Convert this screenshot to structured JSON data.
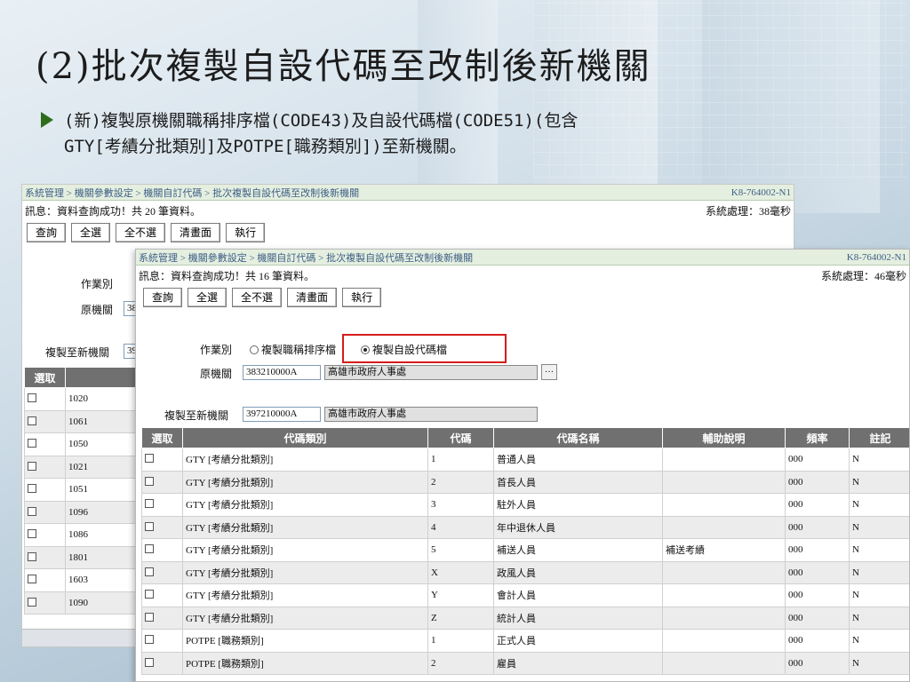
{
  "slide": {
    "title": "(2)批次複製自設代碼至改制後新機關",
    "bullet_line1": "(新)複製原機關職稱排序檔(CODE43)及自設代碼檔(CODE51)(包含",
    "bullet_line2": "GTY[考績分批類別]及POTPE[職務類別])至新機關。"
  },
  "back_window": {
    "breadcrumb": "系統管理 > 機關參數設定 > 機關自訂代碼 > 批次複製自設代碼至改制後新機關",
    "page_code": "K8-764002-N1",
    "message": "訊息：資料查詢成功！共 20 筆資料。",
    "timing": "系統處理：38毫秒",
    "buttons": [
      "查詢",
      "全選",
      "全不選",
      "清畫面",
      "執行"
    ],
    "label_work_type": "作業別",
    "label_orig_org": "原機關",
    "orig_org_partial": "38",
    "label_target_org": "複製至新機關",
    "target_org_partial": "39",
    "col_select": "選取",
    "codes": [
      "1020",
      "1061",
      "1050",
      "1021",
      "1051",
      "1096",
      "1086",
      "1801",
      "1603",
      "1090"
    ]
  },
  "front_window": {
    "breadcrumb": "系統管理 > 機關參數設定 > 機關自訂代碼 > 批次複製自設代碼至改制後新機關",
    "page_code": "K8-764002-N1",
    "message": "訊息：資料查詢成功！共 16 筆資料。",
    "timing": "系統處理：46毫秒",
    "buttons": {
      "query": "查詢",
      "select_all": "全選",
      "select_none": "全不選",
      "clear": "清畫面",
      "execute": "執行"
    },
    "work_type": {
      "label": "作業別",
      "option1": "複製職稱排序檔",
      "option2": "複製自設代碼檔",
      "selected": "option2"
    },
    "orig_org": {
      "label": "原機關",
      "code": "383210000A",
      "name": "高雄市政府人事處"
    },
    "target_org": {
      "label": "複製至新機關",
      "code": "397210000A",
      "name": "高雄市政府人事處"
    },
    "columns": [
      "選取",
      "代碼類別",
      "代碼",
      "代碼名稱",
      "輔助說明",
      "頻率",
      "註記"
    ],
    "rows": [
      {
        "category": "GTY [考績分批類別]",
        "code": "1",
        "name": "普通人員",
        "note": "",
        "freq": "000",
        "flag": "N"
      },
      {
        "category": "GTY [考績分批類別]",
        "code": "2",
        "name": "首長人員",
        "note": "",
        "freq": "000",
        "flag": "N"
      },
      {
        "category": "GTY [考績分批類別]",
        "code": "3",
        "name": "駐外人員",
        "note": "",
        "freq": "000",
        "flag": "N"
      },
      {
        "category": "GTY [考績分批類別]",
        "code": "4",
        "name": "年中退休人員",
        "note": "",
        "freq": "000",
        "flag": "N"
      },
      {
        "category": "GTY [考績分批類別]",
        "code": "5",
        "name": "補送人員",
        "note": "補送考績",
        "freq": "000",
        "flag": "N"
      },
      {
        "category": "GTY [考績分批類別]",
        "code": "X",
        "name": "政風人員",
        "note": "",
        "freq": "000",
        "flag": "N"
      },
      {
        "category": "GTY [考績分批類別]",
        "code": "Y",
        "name": "會計人員",
        "note": "",
        "freq": "000",
        "flag": "N"
      },
      {
        "category": "GTY [考績分批類別]",
        "code": "Z",
        "name": "統計人員",
        "note": "",
        "freq": "000",
        "flag": "N"
      },
      {
        "category": "POTPE [職務類別]",
        "code": "1",
        "name": "正式人員",
        "note": "",
        "freq": "000",
        "flag": "N"
      },
      {
        "category": "POTPE [職務類別]",
        "code": "2",
        "name": "雇員",
        "note": "",
        "freq": "000",
        "flag": "N"
      }
    ]
  }
}
